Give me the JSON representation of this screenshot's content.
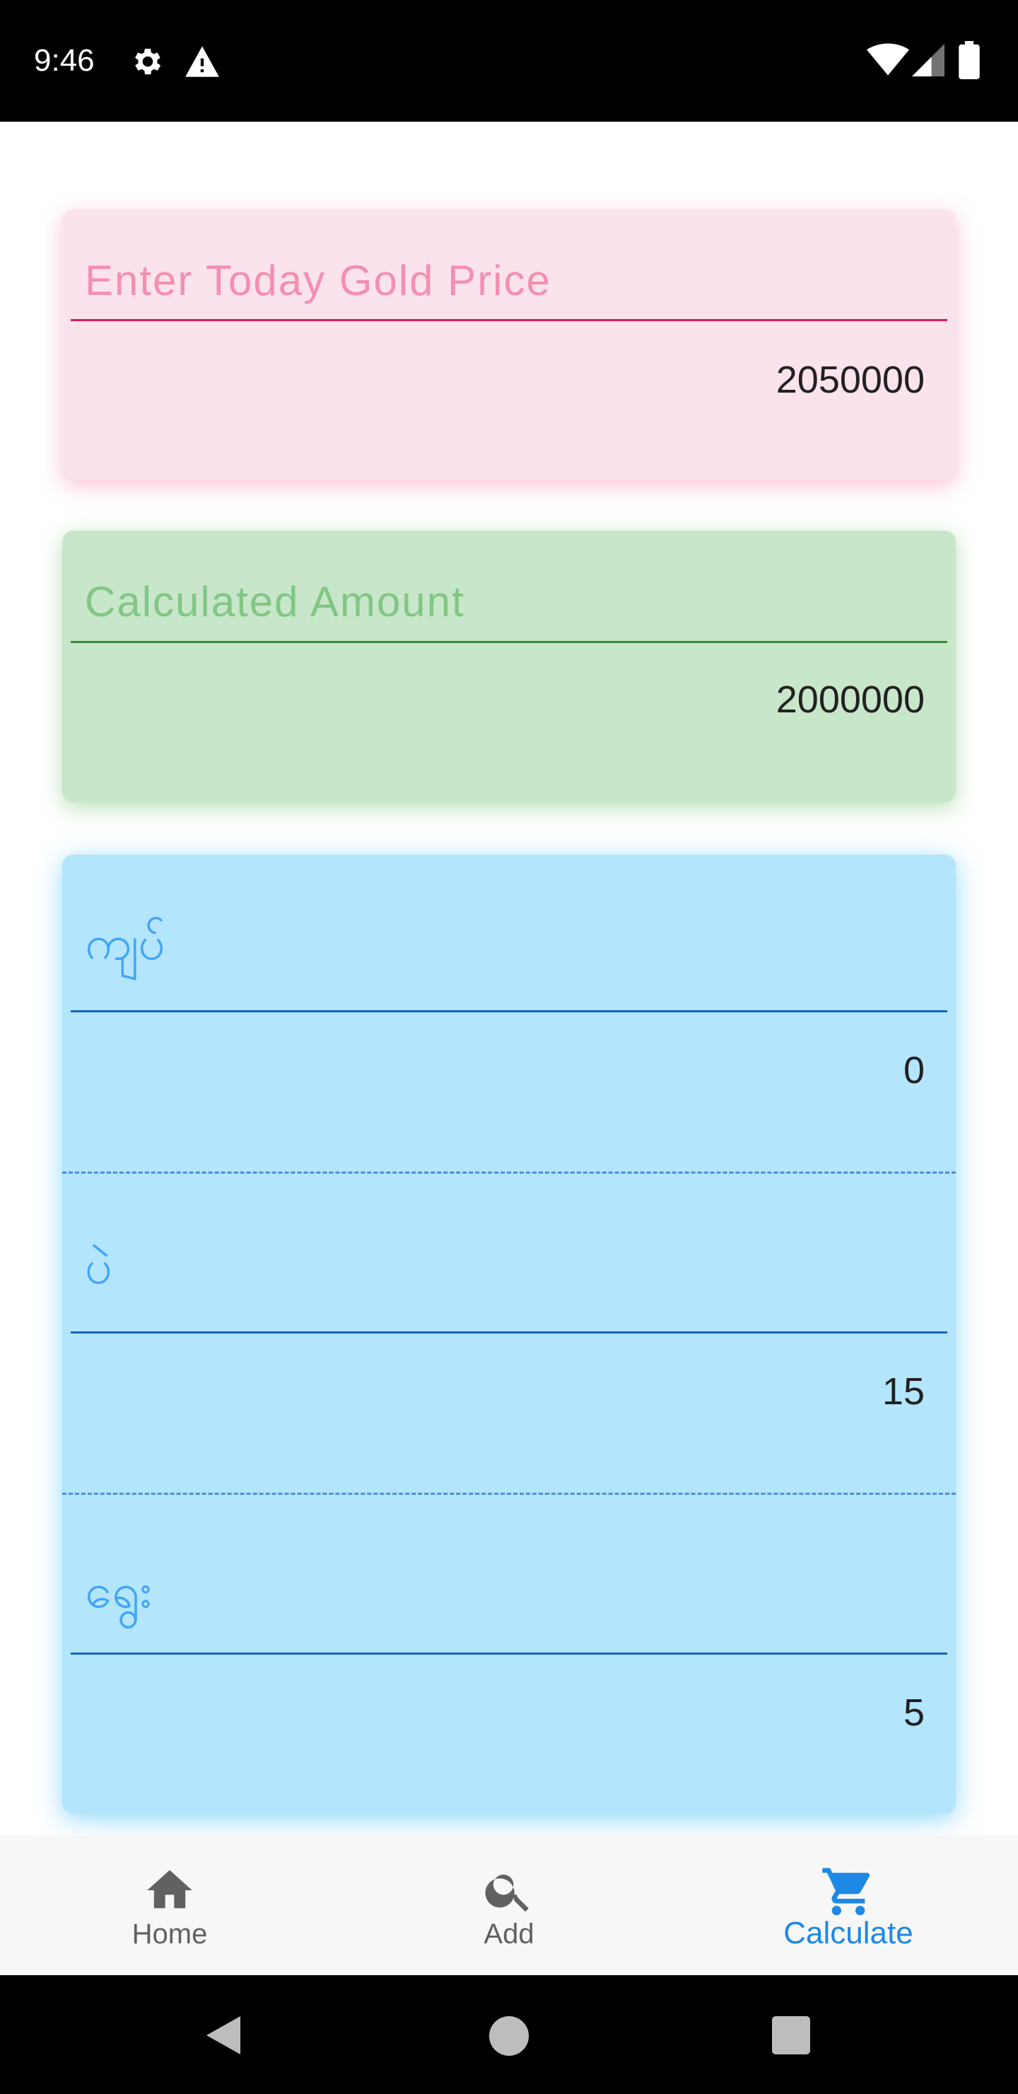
{
  "status_bar": {
    "time": "9:46",
    "icons": [
      "settings-gear-icon",
      "warning-icon",
      "wifi-icon",
      "signal-icon",
      "battery-icon"
    ]
  },
  "cards": {
    "gold_price": {
      "label": "Enter Today Gold Price",
      "value": "2050000",
      "accent": "#d81b60",
      "label_color": "#f48fb1"
    },
    "calculated": {
      "label": "Calculated Amount",
      "value": "2000000",
      "accent": "#388e3c",
      "label_color": "#81c784"
    },
    "weights": {
      "accent": "#1565c0",
      "label_color": "#42a5f5",
      "fields": [
        {
          "label": "ကျပ်",
          "value": "0"
        },
        {
          "label": "ပဲ",
          "value": "15"
        },
        {
          "label": "ရွေး",
          "value": "5"
        }
      ]
    }
  },
  "bottom_nav": {
    "items": [
      {
        "label": "Home",
        "icon": "home-icon",
        "active": false
      },
      {
        "label": "Add",
        "icon": "search-icon",
        "active": false
      },
      {
        "label": "Calculate",
        "icon": "cart-icon",
        "active": true
      }
    ],
    "active_color": "#1e88e5",
    "inactive_color": "#616161"
  },
  "system_nav": {
    "icons": [
      "back-icon",
      "home-circle-icon",
      "recents-icon"
    ]
  }
}
